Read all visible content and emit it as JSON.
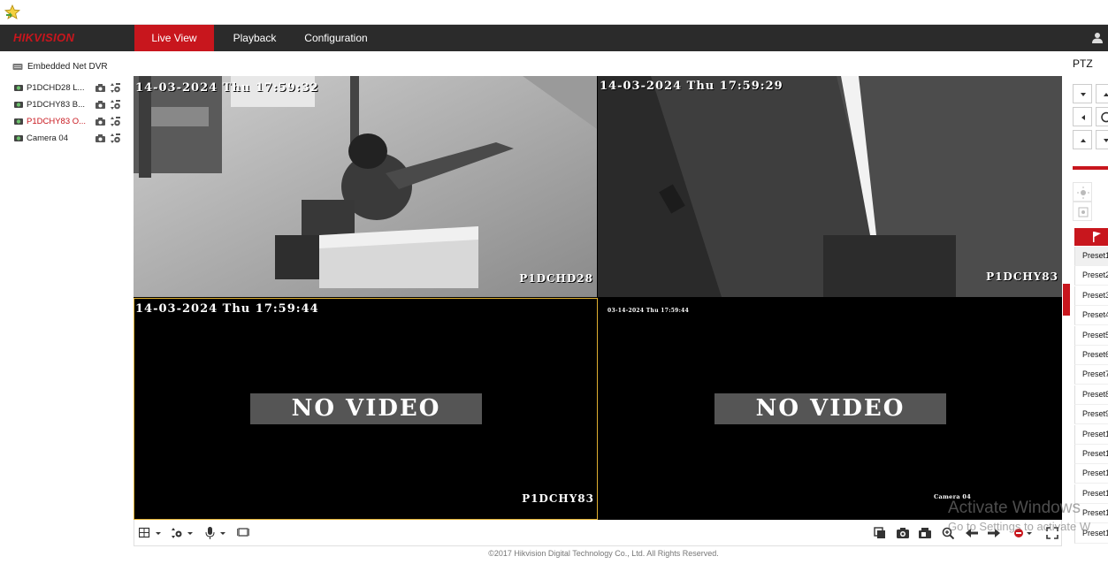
{
  "app": {
    "brand_part1": "HIK",
    "brand_part2": "VISION"
  },
  "nav": {
    "tabs": [
      {
        "label": "Live View",
        "active": true
      },
      {
        "label": "Playback",
        "active": false
      },
      {
        "label": "Configuration",
        "active": false
      }
    ]
  },
  "sidebar": {
    "device": "Embedded Net DVR",
    "cameras": [
      {
        "label": "P1DCHD28 L...",
        "selected": false
      },
      {
        "label": "P1DCHY83 B...",
        "selected": false
      },
      {
        "label": "P1DCHY83 O...",
        "selected": true
      },
      {
        "label": "Camera 04",
        "selected": false
      }
    ]
  },
  "tiles": [
    {
      "timestamp": "14-03-2024 Thu 17:59:32",
      "name": "P1DCHD28",
      "no_video": false
    },
    {
      "timestamp": "14-03-2024 Thu 17:59:29",
      "name": "P1DCHY83",
      "no_video": false
    },
    {
      "timestamp": "14-03-2024 Thu 17:59:44",
      "name": "P1DCHY83",
      "no_video": true,
      "no_video_label": "NO VIDEO"
    },
    {
      "timestamp": "03-14-2024 Thu 17:59:44",
      "name": "Camera 04",
      "no_video": true,
      "no_video_label": "NO VIDEO"
    }
  ],
  "ptz": {
    "title": "PTZ",
    "presets": [
      "Preset1",
      "Preset2",
      "Preset3",
      "Preset4",
      "Preset5",
      "Preset6",
      "Preset7",
      "Preset8",
      "Preset9",
      "Preset1",
      "Preset1",
      "Preset1",
      "Preset1",
      "Preset1",
      "Preset1"
    ]
  },
  "footer": {
    "copyright": "©2017 Hikvision Digital Technology Co., Ltd. All Rights Reserved."
  },
  "watermark": {
    "line1": "Activate Windows",
    "line2": "Go to Settings to activate W"
  },
  "colors": {
    "accent": "#c8161d",
    "navbar": "#2b2b2b",
    "selected_border": "#e0b030"
  },
  "icons": {
    "favorites": "star-icon",
    "user": "user-icon",
    "device": "dvr-icon"
  }
}
